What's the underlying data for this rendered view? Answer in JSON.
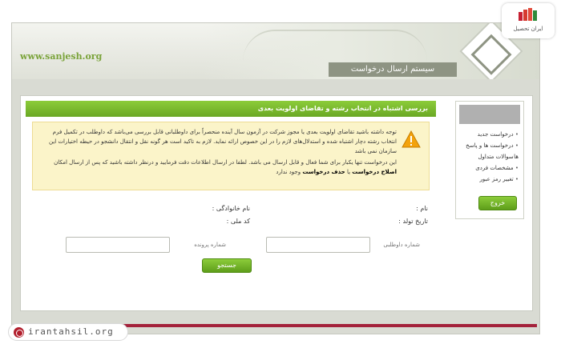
{
  "header": {
    "site_url": "www.sanjesh.org",
    "system_title": "سیستم ارسال درخواست"
  },
  "sidebar": {
    "items": [
      {
        "label": "درخواست جدید"
      },
      {
        "label": "درخواست ها و پاسخ ها"
      },
      {
        "label": "سوالات متداول"
      },
      {
        "label": "مشخصات فردی"
      },
      {
        "label": "تغییر رمز عبور"
      }
    ],
    "exit_label": "خروج"
  },
  "main": {
    "panel_title": "بررسی اشتباه در انتخاب رشته و تقاضای اولویت بعدی",
    "notice": {
      "line1": "توجه داشته باشید تقاضای اولویت بعدی یا مجوز شرکت در آزمون سال آینده منحصراً برای داوطلبانی قابل بررسی می‌باشد که داوطلب در تکمیل فرم انتخاب رشته دچار اشتباه شده و استدلال‌های لازم را در این خصوص ارائه نماید. لازم به تاکید است هر گونه نقل و انتقال دانشجو در حیطه اختیارات این سازمان نمی باشد",
      "line2_start": "این درخواست تنها یکبار برای شما فعال و قابل ارسال می باشد. لطفا در ارسال اطلاعات دقت فرمایید و درنظر داشته باشید که پس از ارسال امکان",
      "edit_bold": "اصلاح درخواست",
      "and": "یا",
      "delete_bold": "حذف درخواست",
      "line2_end": "وجود ندارد"
    },
    "form": {
      "name_label": "نام :",
      "family_label": "نام خانوادگی :",
      "birth_label": "تاریخ تولد :",
      "national_code_label": "کد ملی :",
      "applicant_no_label": "شماره داوطلبی",
      "case_no_label": "شماره پرونده",
      "applicant_no_value": "",
      "case_no_value": "",
      "search_label": "جستجو"
    }
  },
  "badge": {
    "brand": "ایران تحصیل"
  },
  "watermark": {
    "url": "irantahsil.org"
  },
  "colors": {
    "accent_green": "#6aa824",
    "notice_bg": "#fbf4c9",
    "footer_red": "#a4223b"
  }
}
